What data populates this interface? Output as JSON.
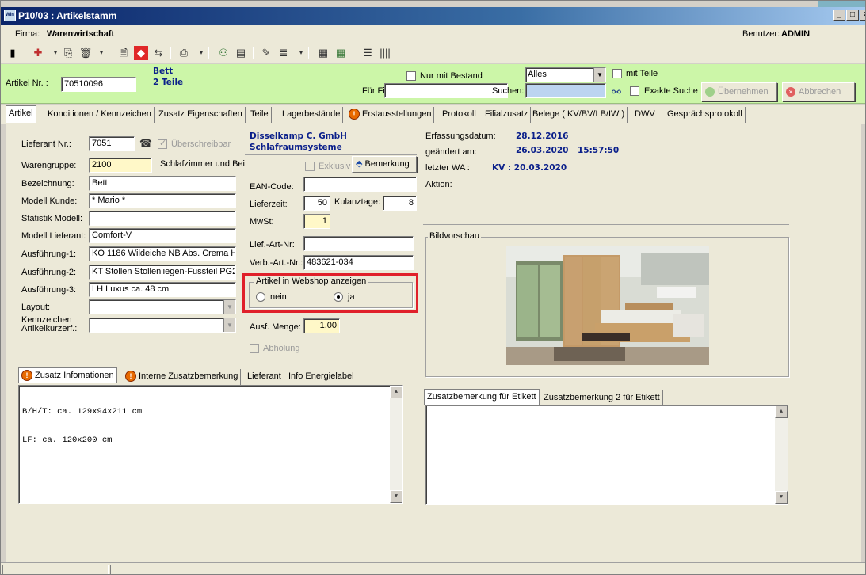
{
  "window": {
    "title": "P10/03 : Artikelstamm",
    "app_icon_label": "Win",
    "controls": [
      "_",
      "□",
      "×"
    ]
  },
  "firm": {
    "label": "Firma:",
    "value": "Warenwirtschaft",
    "user_label": "Benutzer:",
    "user_value": "ADMIN"
  },
  "toolbar": {
    "icons": [
      "exit-icon",
      "new-icon",
      "copy-icon",
      "delete-icon",
      "doc-icon",
      "tag-icon",
      "car-icon",
      "print-icon",
      "users-icon",
      "clipboard-icon",
      "edit-icon",
      "list-icon",
      "calc-icon",
      "table-icon",
      "tree-icon",
      "barcode-icon"
    ]
  },
  "search": {
    "article_label": "Artikel Nr. :",
    "article_value": "70510096",
    "desc_line1": "Bett",
    "desc_line2": "2 Teile",
    "stock_only_label": "Nur mit Bestand",
    "branch_label": "Für Fil:",
    "branch_value": "",
    "filter_value": "Alles",
    "search_label": "Suchen:",
    "search_value": "",
    "with_parts_label": "mit Teile",
    "exact_label": "Exakte Suche",
    "apply_label": "Übernehmen",
    "cancel_label": "Abbrechen"
  },
  "tabs": [
    "Artikel",
    "Konditionen / Kennzeichen",
    "Zusatz Eigenschaften",
    "Teile",
    "Lagerbestände",
    "Erstausstellungen",
    "Protokoll",
    "Filialzusatz",
    "Belege ( KV/BV/LB/IW )",
    "DWV",
    "Gesprächsprotokoll"
  ],
  "artikel": {
    "lieferant_label": "Lieferant Nr.:",
    "lieferant_value": "7051",
    "overwrite_label": "Überschreibbar",
    "warengruppe_label": "Warengruppe:",
    "warengruppe_value": "2100",
    "warengruppe_text": "Schlafzimmer und Bei",
    "bezeichnung_label": "Bezeichnung:",
    "bezeichnung_value": "Bett",
    "modell_kunde_label": "Modell Kunde:",
    "modell_kunde_value": "* Mario *",
    "statistik_label": "Statistik Modell:",
    "statistik_value": "",
    "modell_lieferant_label": "Modell Lieferant:",
    "modell_lieferant_value": "Comfort-V",
    "ausf1_label": "Ausführung-1:",
    "ausf1_value": "KO 1186 Wildeiche NB Abs. Crema H",
    "ausf2_label": "Ausführung-2:",
    "ausf2_value": "KT Stollen Stollenliegen-Fussteil PG2",
    "ausf3_label": "Ausführung-3:",
    "ausf3_value": "LH Luxus ca. 48 cm",
    "layout_label": "Layout:",
    "kennz_label_1": "Kennzeichen",
    "kennz_label_2": "Artikelkurzerf.:",
    "supplier_name_1": "Disselkamp C. GmbH",
    "supplier_name_2": "Schlafraumsysteme",
    "exklusiv_label": "Exklusiv",
    "bemerkung_label": "Bemerkung",
    "ean_label": "EAN-Code:",
    "ean_value": "",
    "lieferzeit_label": "Lieferzeit:",
    "lieferzeit_value": "50",
    "kulanz_label": "Kulanztage:",
    "kulanz_value": "8",
    "mwst_label": "MwSt:",
    "mwst_value": "1",
    "lief_art_label": "Lief.-Art-Nr:",
    "lief_art_value": "",
    "verb_art_label": "Verb.-Art.-Nr.:",
    "verb_art_value": "483621-034",
    "webshop_title": "Artikel in Webshop anzeigen",
    "webshop_no": "nein",
    "webshop_yes": "ja",
    "webshop_selected": "ja",
    "ausf_menge_label": "Ausf. Menge:",
    "ausf_menge_value": "1,00",
    "abholung_label": "Abholung",
    "erfassung_label": "Erfassungsdatum:",
    "erfassung_value": "28.12.2016",
    "geaendert_label": "geändert am:",
    "geaendert_date": "26.03.2020",
    "geaendert_time": "15:57:50",
    "letzter_wa_label": "letzter WA :",
    "letzter_wa_value": "KV : 20.03.2020",
    "aktion_label": "Aktion:",
    "bildvorschau_label": "Bildvorschau"
  },
  "lower_tabs": [
    "Zusatz Infomationen",
    "Interne Zusatzbemerkung",
    "Lieferant",
    "Info Energielabel"
  ],
  "zusatz_text_line1": "B/H/T: ca. 129x94x211 cm",
  "zusatz_text_line2": "LF: ca. 120x200 cm",
  "etikett_tabs": [
    "Zusatzbemerkung für Etikett",
    "Zusatzbemerkung 2 für Etikett"
  ],
  "colors": {
    "search_bar": "#ccf6a8",
    "highlight_red": "#e0202a",
    "supplier_blue": "#0a1f8a",
    "title_bar": "#0a246a"
  }
}
